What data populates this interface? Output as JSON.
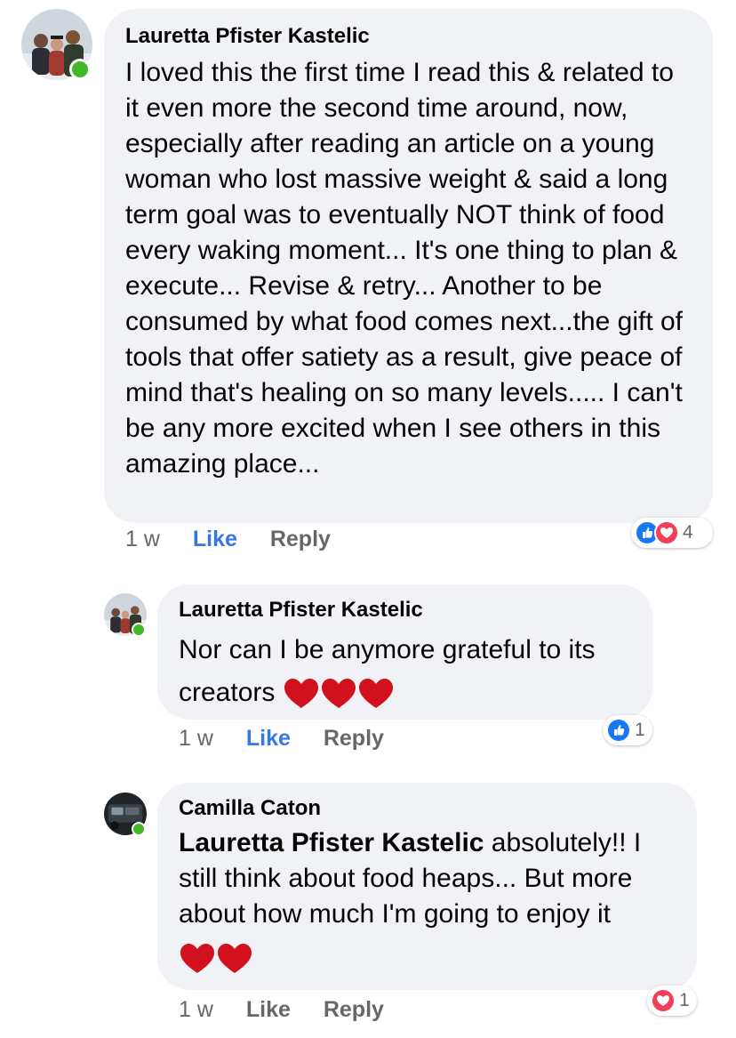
{
  "colors": {
    "bubble": "#f0f2f5",
    "like_active": "#3578e5",
    "meta_text": "#65676b",
    "online": "#42b72a",
    "like_reaction": "#1877f2",
    "love_reaction": "#f33e58"
  },
  "comments": [
    {
      "author": "Lauretta Pfister Kastelic",
      "text": "I loved this the first time I read this & related to it even more the second time around, now,  especially after reading an article on a young woman who lost massive weight & said a long term goal was to eventually NOT think of food every waking moment... It's one thing to plan & execute... Revise & retry... Another to be consumed by what food comes next...the gift of tools that offer satiety as a result, give peace of mind that's healing on so many levels..... I can't be any more excited when I see others in this amazing place...",
      "time": "1 w",
      "like_label": "Like",
      "reply_label": "Reply",
      "reactions": {
        "icons": [
          "like-icon",
          "love-icon"
        ],
        "count": "4"
      },
      "online": true
    },
    {
      "author": "Lauretta Pfister Kastelic",
      "text": "Nor can I be anymore grateful to its creators",
      "hearts": 3,
      "time": "1 w",
      "like_label": "Like",
      "reply_label": "Reply",
      "reactions": {
        "icons": [
          "like-icon"
        ],
        "count": "1"
      },
      "online": true
    },
    {
      "author": "Camilla Caton",
      "mention": "Lauretta Pfister Kastelic",
      "text": " absolutely!! I still think about food heaps... But more about how much I'm going to enjoy it",
      "hearts": 2,
      "time": "1 w",
      "like_label": "Like",
      "reply_label": "Reply",
      "reactions": {
        "icons": [
          "love-icon"
        ],
        "count": "1"
      },
      "online": true
    }
  ]
}
